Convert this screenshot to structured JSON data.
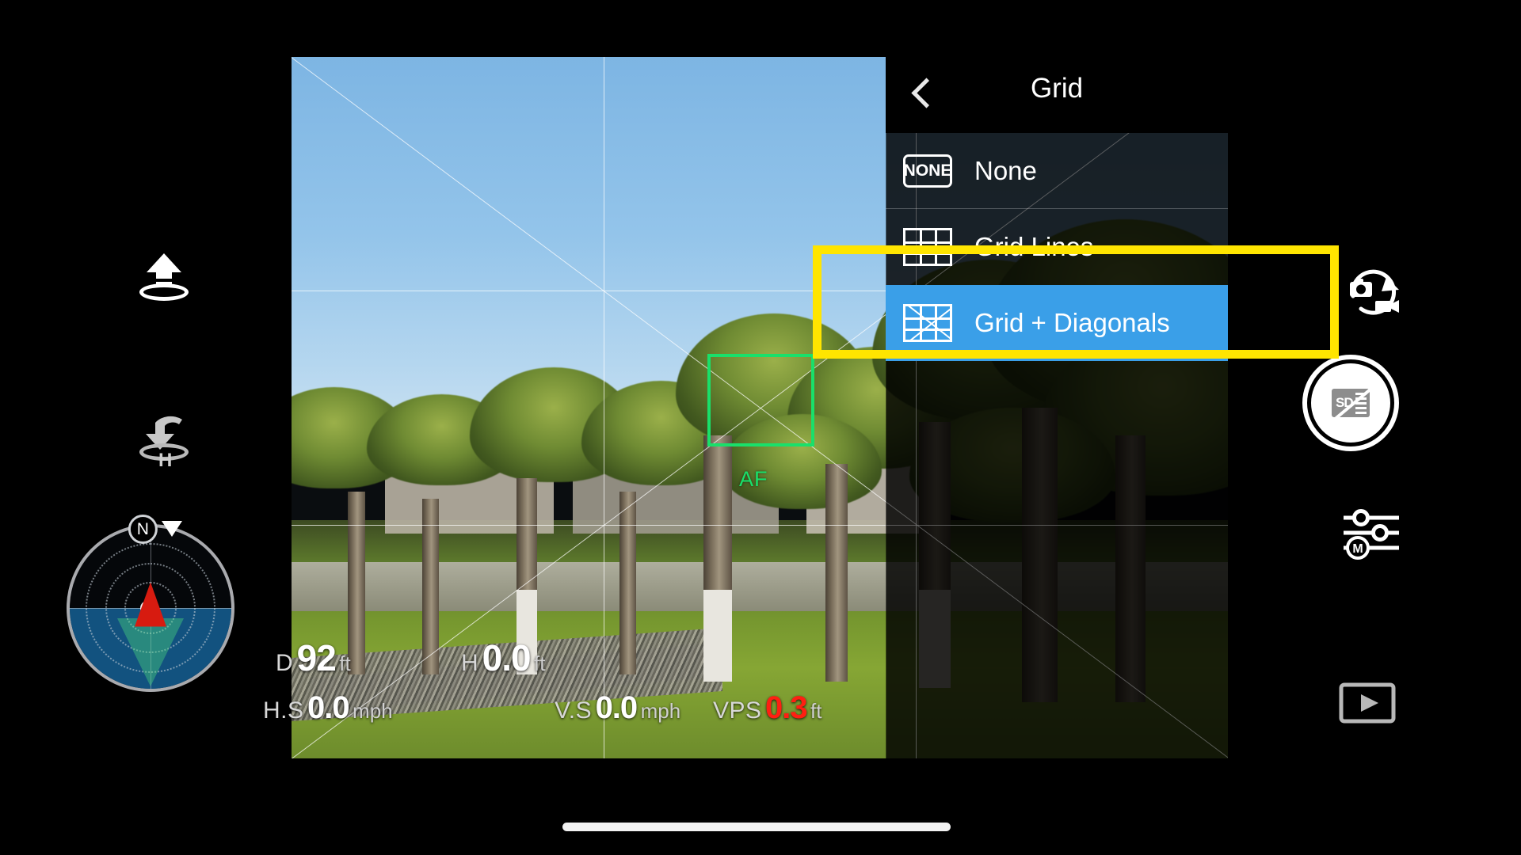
{
  "app": {
    "screen_title": "Grid"
  },
  "menu": {
    "title": "Grid",
    "back_icon": "chevron-left-icon",
    "items": [
      {
        "label": "None",
        "icon": "none-badge-icon",
        "icon_text": "NONE",
        "selected": false
      },
      {
        "label": "Grid Lines",
        "icon": "grid-lines-icon",
        "icon_text": "",
        "selected": false
      },
      {
        "label": "Grid + Diagonals",
        "icon": "grid-diagonals-icon",
        "icon_text": "",
        "selected": true
      }
    ],
    "selected_label": "Grid + Diagonals",
    "highlight_color": "#ffe500",
    "selection_color": "#3a9fe8"
  },
  "camera": {
    "af_label": "AF",
    "af_color": "#19e06a",
    "grid_mode": "Grid + Diagonals"
  },
  "telemetry": {
    "distance": {
      "label": "D",
      "value": "92",
      "unit": "ft",
      "alert": false
    },
    "height": {
      "label": "H",
      "value": "0.0",
      "unit": "ft",
      "alert": false
    },
    "horiz_speed": {
      "label": "H.S",
      "value": "0.0",
      "unit": "mph",
      "alert": false
    },
    "vert_speed": {
      "label": "V.S",
      "value": "0.0",
      "unit": "mph",
      "alert": false
    },
    "vps": {
      "label": "VPS",
      "value": "0.3",
      "unit": "ft",
      "alert": true
    },
    "alert_color": "#ff1f12"
  },
  "compass": {
    "north_label": "N"
  },
  "left_controls": [
    {
      "name": "takeoff-button",
      "icon": "takeoff-arrow-icon"
    },
    {
      "name": "return-to-home-button",
      "icon": "return-home-icon",
      "icon_text": "H"
    }
  ],
  "right_controls": {
    "mode_toggle": {
      "name": "photo-video-toggle",
      "icon": "camera-video-switch-icon"
    },
    "shutter": {
      "name": "shutter-button",
      "icon": "sd-card-none-icon",
      "icon_text": "SD"
    },
    "camera_settings": {
      "name": "camera-settings-button",
      "icon": "sliders-manual-icon",
      "icon_text": "M"
    },
    "playback": {
      "name": "playback-button",
      "icon": "play-rect-icon"
    }
  }
}
